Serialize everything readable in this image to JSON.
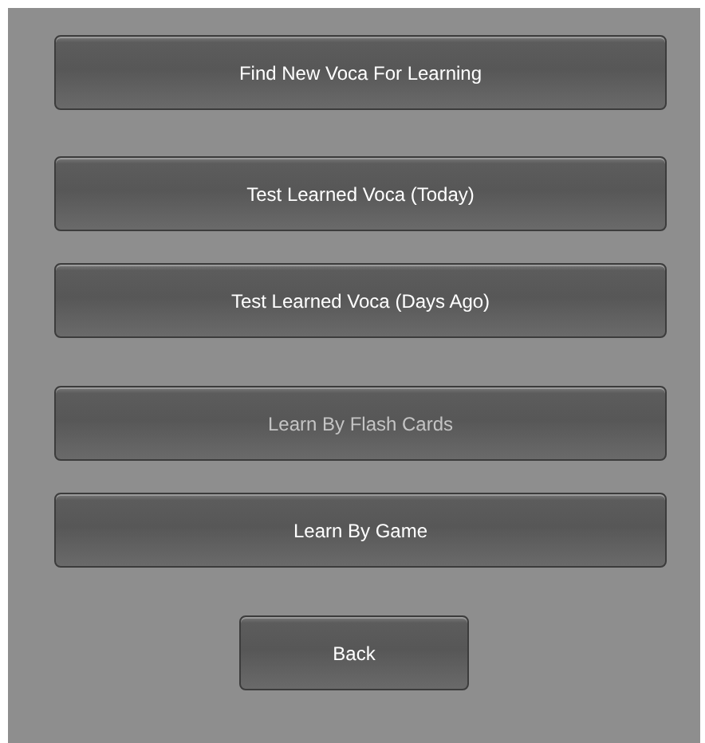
{
  "menu_buttons": [
    {
      "label": "Find New Voca For Learning",
      "disabled": false
    },
    {
      "label": "Test Learned Voca (Today)",
      "disabled": false
    },
    {
      "label": "Test Learned Voca (Days Ago)",
      "disabled": false
    },
    {
      "label": "Learn By Flash Cards",
      "disabled": true
    },
    {
      "label": "Learn By Game",
      "disabled": false
    }
  ],
  "back_button": {
    "label": "Back"
  }
}
